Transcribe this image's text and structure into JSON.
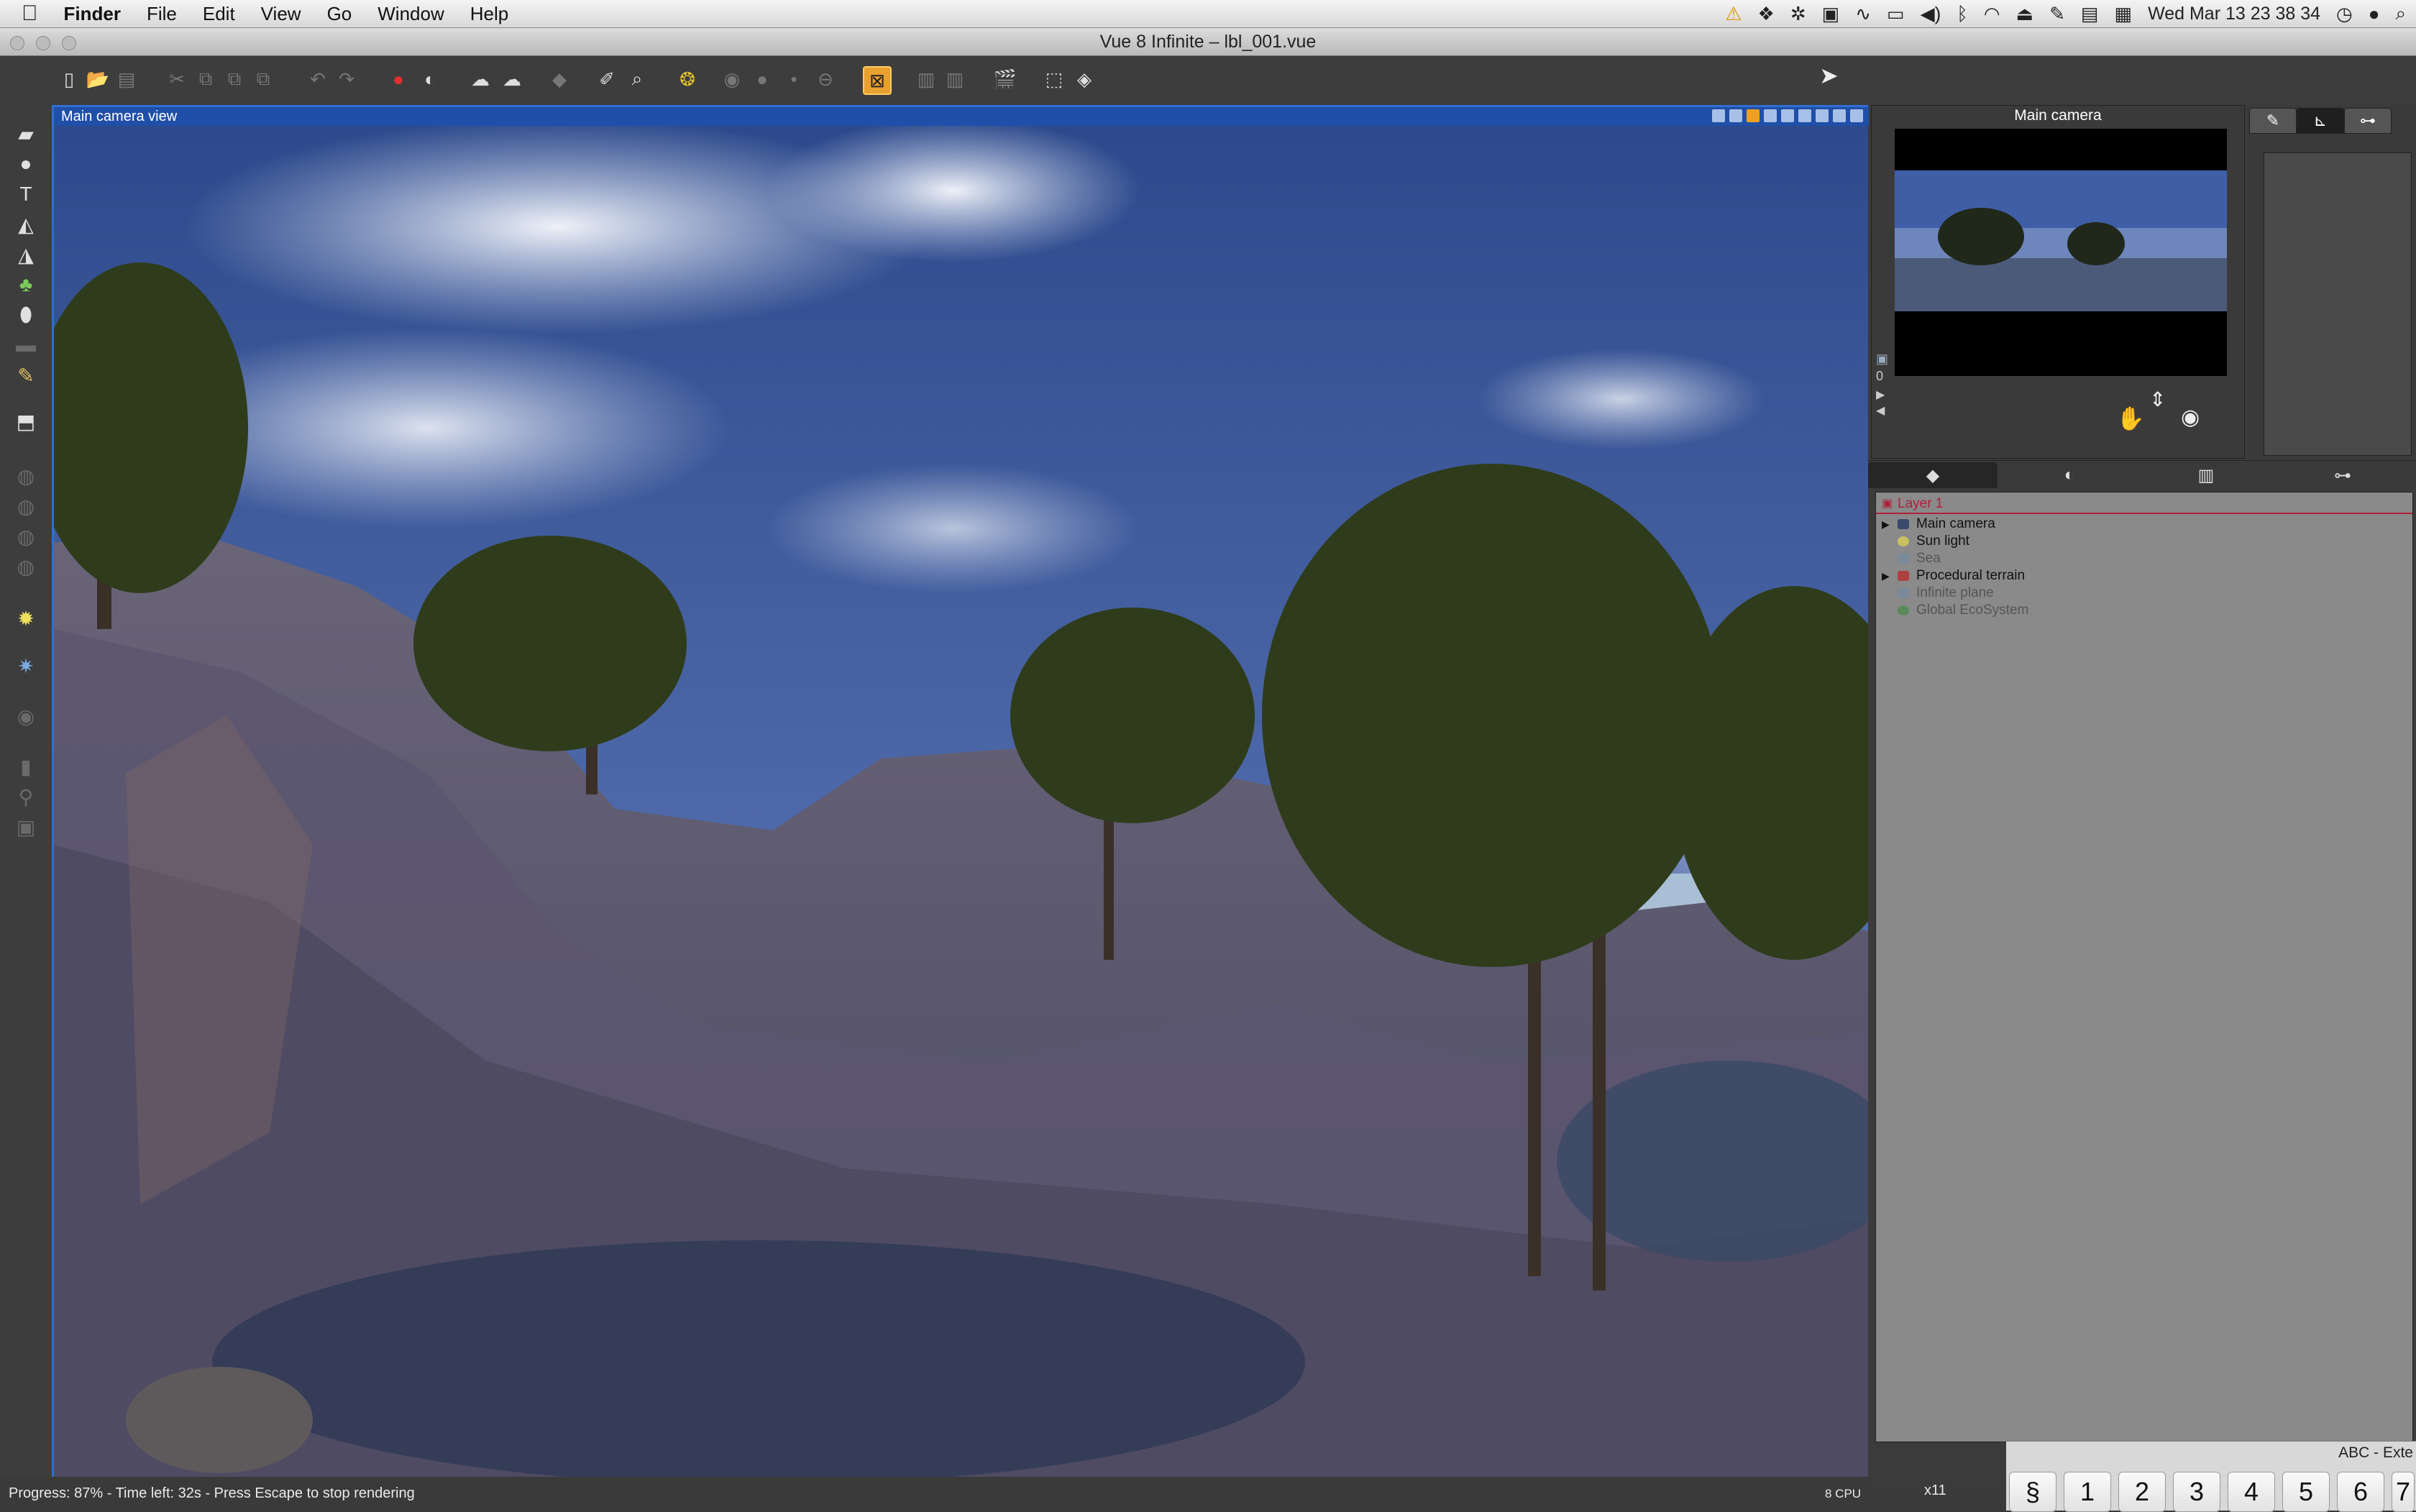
{
  "menubar": {
    "app": "Finder",
    "items": [
      "File",
      "Edit",
      "View",
      "Go",
      "Window",
      "Help"
    ],
    "clock": "Wed Mar 13  23 38 34"
  },
  "window": {
    "title": "Vue 8 Infinite – lbl_001.vue"
  },
  "viewport": {
    "title": "Main camera view"
  },
  "camera_panel": {
    "title": "Main camera",
    "frame_counter": "0"
  },
  "world_browser": {
    "layer": "Layer 1",
    "objects": [
      {
        "label": "Main camera",
        "icon": "camera-icon",
        "expandable": true,
        "dim": false
      },
      {
        "label": "Sun light",
        "icon": "sun-icon",
        "expandable": false,
        "dim": false
      },
      {
        "label": "Sea",
        "icon": "plane-icon",
        "expandable": false,
        "dim": true
      },
      {
        "label": "Procedural terrain",
        "icon": "terrain-icon",
        "expandable": true,
        "dim": false
      },
      {
        "label": "Infinite plane",
        "icon": "plane-icon",
        "expandable": false,
        "dim": true
      },
      {
        "label": "Global EcoSystem",
        "icon": "ecosystem-icon",
        "expandable": false,
        "dim": true
      }
    ]
  },
  "statusbar": {
    "progress_text": "Progress: 87% - Time left: 32s - Press Escape to stop rendering",
    "cpu": "8 CPU",
    "zoom": "x11"
  },
  "keyboard_viewer": {
    "title": "ABC - Exte",
    "keys": [
      "§",
      "1",
      "2",
      "3",
      "4",
      "5",
      "6",
      "7"
    ]
  },
  "colors": {
    "accent": "#2f6fd1",
    "active_tool": "#e8a030",
    "layer_line": "#b0203a"
  }
}
